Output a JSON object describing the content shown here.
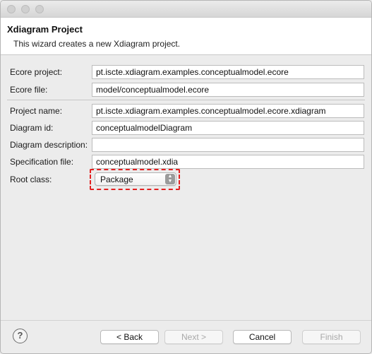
{
  "window": {
    "title": ""
  },
  "banner": {
    "title": "Xdiagram Project",
    "description": "This wizard creates a new Xdiagram project."
  },
  "form": {
    "ecore_project": {
      "label": "Ecore project:",
      "value": "pt.iscte.xdiagram.examples.conceptualmodel.ecore"
    },
    "ecore_file": {
      "label": "Ecore file:",
      "value": "model/conceptualmodel.ecore"
    },
    "project_name": {
      "label": "Project name:",
      "value": "pt.iscte.xdiagram.examples.conceptualmodel.ecore.xdiagram"
    },
    "diagram_id": {
      "label": "Diagram id:",
      "value": "conceptualmodelDiagram"
    },
    "diagram_description": {
      "label": "Diagram description:",
      "value": ""
    },
    "specification_file": {
      "label": "Specification file:",
      "value": "conceptualmodel.xdia"
    },
    "root_class": {
      "label": "Root class:",
      "selected": "Package"
    }
  },
  "footer": {
    "help_glyph": "?",
    "back_label": "< Back",
    "next_label": "Next >",
    "cancel_label": "Cancel",
    "finish_label": "Finish"
  },
  "colors": {
    "highlight": "#e32020",
    "banner_bg": "#ffffff",
    "dialog_bg": "#ececec"
  }
}
